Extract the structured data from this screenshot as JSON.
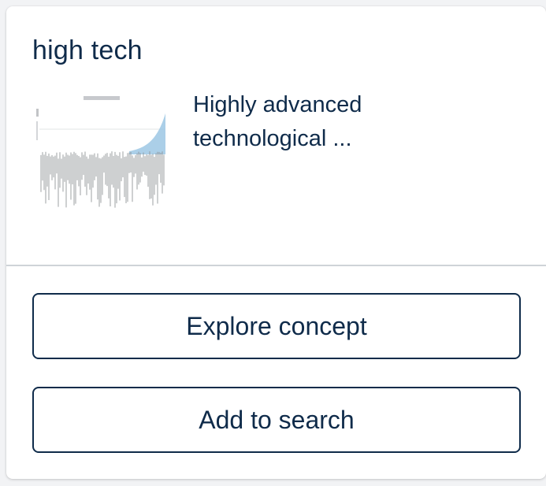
{
  "card": {
    "title": "high tech",
    "description": "Highly advanced technological ...",
    "thumbnail": {
      "icon": "sparkline-chart-thumbnail",
      "accent_color": "#9cc7e4"
    }
  },
  "actions": {
    "explore_label": "Explore concept",
    "add_label": "Add to search"
  },
  "colors": {
    "text": "#0f2b4a",
    "border": "#0f2b4a",
    "divider": "#cfd3d8"
  }
}
